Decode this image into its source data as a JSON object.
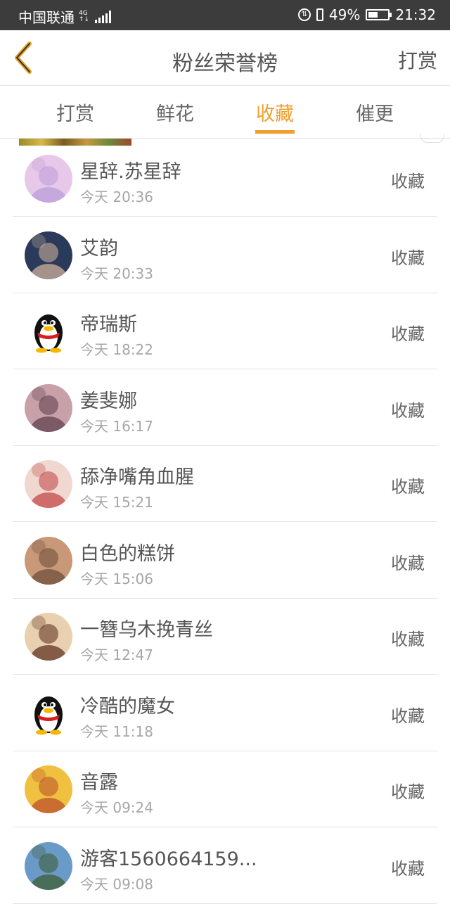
{
  "status_bar": {
    "carrier": "中国联通",
    "network": "4G",
    "battery_percent": "49%",
    "battery_level": 0.49,
    "time": "21:32"
  },
  "header": {
    "back_icon": "chevron-left-icon",
    "title": "粉丝荣誉榜",
    "right_link": "打赏"
  },
  "tabs": [
    {
      "label": "打赏",
      "active": false
    },
    {
      "label": "鲜花",
      "active": false
    },
    {
      "label": "收藏",
      "active": true
    },
    {
      "label": "催更",
      "active": false
    }
  ],
  "accent_color": "#f0a030",
  "fans": [
    {
      "name": "星辞.苏星辞",
      "time": "今天 20:36",
      "action": "收藏",
      "avatar": "anime-girl-avatar",
      "avatar_colors": [
        "#e8c8e8",
        "#b89ad8"
      ]
    },
    {
      "name": "艾韵",
      "time": "今天 20:33",
      "action": "收藏",
      "avatar": "game-character-avatar",
      "avatar_colors": [
        "#2a3a5a",
        "#d8b8a0"
      ]
    },
    {
      "name": "帝瑞斯",
      "time": "今天 18:22",
      "action": "收藏",
      "avatar": "qq-penguin-avatar",
      "avatar_colors": [
        "#ffffff",
        "#111111"
      ]
    },
    {
      "name": "姜斐娜",
      "time": "今天 16:17",
      "action": "收藏",
      "avatar": "portrait-girl-avatar",
      "avatar_colors": [
        "#c8a0a8",
        "#5a3a48"
      ]
    },
    {
      "name": "舔净嘴角血腥",
      "time": "今天 15:21",
      "action": "收藏",
      "avatar": "anime-girl-red-avatar",
      "avatar_colors": [
        "#f0d8d0",
        "#c04040"
      ]
    },
    {
      "name": "白色的糕饼",
      "time": "今天 15:06",
      "action": "收藏",
      "avatar": "photo-girl-avatar",
      "avatar_colors": [
        "#c89878",
        "#6a4a38"
      ]
    },
    {
      "name": "一簪乌木挽青丝",
      "time": "今天 12:47",
      "action": "收藏",
      "avatar": "dessert-avatar",
      "avatar_colors": [
        "#e8d0b0",
        "#5a2a1a"
      ]
    },
    {
      "name": "冷酷的魔女",
      "time": "今天 11:18",
      "action": "收藏",
      "avatar": "qq-penguin-avatar",
      "avatar_colors": [
        "#ffffff",
        "#111111"
      ]
    },
    {
      "name": "音露",
      "time": "今天 09:24",
      "action": "收藏",
      "avatar": "umbrella-girl-avatar",
      "avatar_colors": [
        "#f0c040",
        "#b84a2a"
      ]
    },
    {
      "name": "游客1560664159...",
      "time": "今天 09:08",
      "action": "收藏",
      "avatar": "landscape-avatar",
      "avatar_colors": [
        "#6a9ac8",
        "#3a5a2a"
      ]
    }
  ]
}
